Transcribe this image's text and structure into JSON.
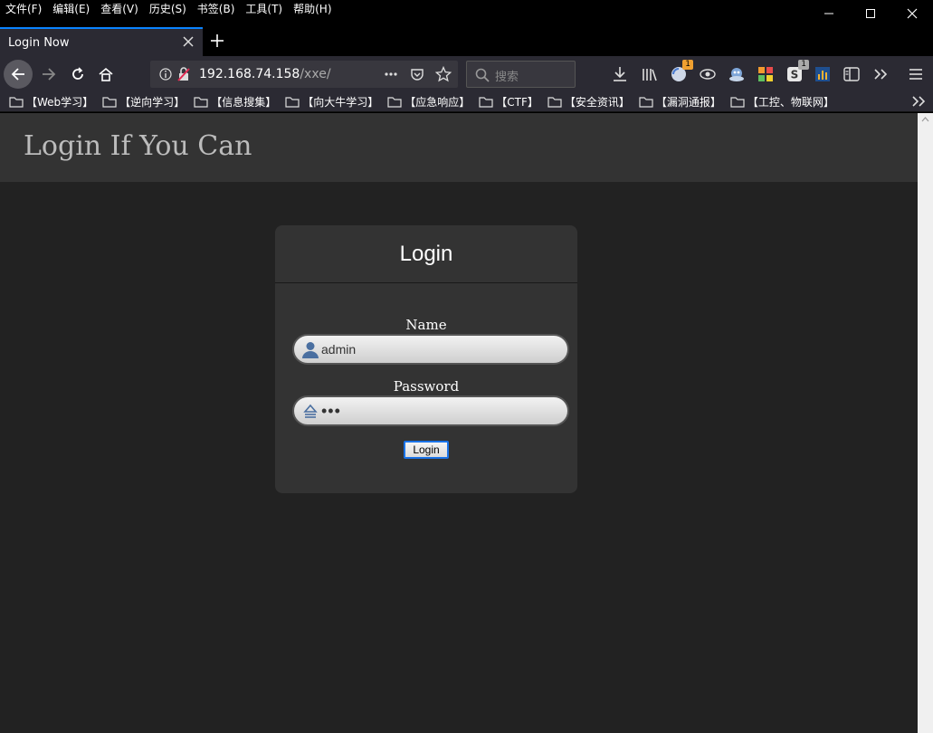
{
  "menu": [
    "文件(F)",
    "编辑(E)",
    "查看(V)",
    "历史(S)",
    "书签(B)",
    "工具(T)",
    "帮助(H)"
  ],
  "tab": {
    "title": "Login Now"
  },
  "nav": {
    "url_host": "192.168.74.158",
    "url_path": "/xxe/",
    "search_placeholder": "搜索",
    "badge_one": "1",
    "badge_two": "1"
  },
  "bookmarks": [
    "【Web学习】",
    "【逆向学习】",
    "【信息搜集】",
    "【向大牛学习】",
    "【应急响应】",
    "【CTF】",
    "【安全资讯】",
    "【漏洞通报】",
    "【工控、物联网】"
  ],
  "page": {
    "site_title": "Login If You Can",
    "login": {
      "title": "Login",
      "name_label": "Name",
      "name_value": "admin",
      "password_label": "Password",
      "password_value": "•••",
      "button_label": "Login"
    }
  },
  "colors": {
    "accent": "#0a84ff",
    "page_bg": "#222222",
    "header_bg": "#333333",
    "toolbar_bg": "#2b2a33"
  }
}
